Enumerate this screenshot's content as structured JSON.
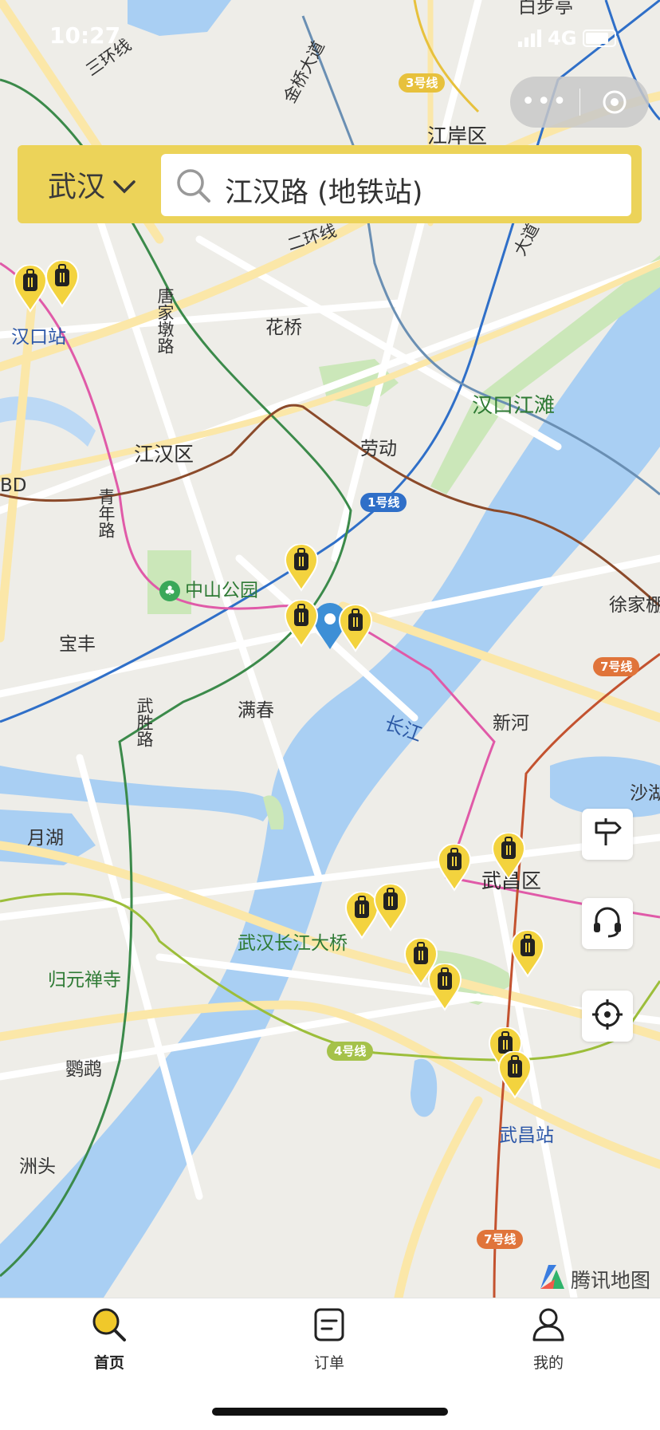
{
  "status_bar": {
    "time": "10:27",
    "network": "4G"
  },
  "capsule": {
    "more_icon": "more-dots-icon",
    "close_icon": "target-circle-icon"
  },
  "search": {
    "city": "武汉",
    "city_icon": "chevron-down-icon",
    "value": "江汉路 (地铁站)",
    "icon": "search-icon"
  },
  "map": {
    "labels": {
      "baibuting": "白步亭",
      "sanhuanxian": "三环线",
      "jinqiao": "金桥大道",
      "jianganqu": "江岸区",
      "erhuanxian": "二环线",
      "dadao": "大道",
      "huaqiao": "花桥",
      "hankouzhan": "汉口站",
      "tangjiadun": "唐家墩路",
      "hankoujiangtan": "汉口江滩",
      "jianghanqu": "江汉区",
      "laodong": "劳动",
      "qingnianlu": "青年路",
      "zhongshangongyuan": "中山公园",
      "xujiapeng": "徐家棚",
      "baofeng": "宝丰",
      "manchun": "满春",
      "changjiang": "长江",
      "xinhe": "新河",
      "wushenglu": "武胜路",
      "yuehu": "月湖",
      "shahu": "沙湖",
      "wuchangqu": "武昌区",
      "wuhanchangjiangdaqiao": "武汉长江大桥",
      "guiyuanchansi": "归元禅寺",
      "yingwu": "鹦鹉",
      "zhoutou": "洲头",
      "wuchangzhan": "武昌站",
      "cbd": "BD"
    },
    "badges": {
      "line3": "3号线",
      "line1": "1号线",
      "line7a": "7号线",
      "line4": "4号线",
      "line7b": "7号线"
    },
    "line_colors": {
      "line1": "#2f6fc8",
      "line3": "#e7c13c",
      "line4": "#9cbe3a",
      "line7": "#c3522f",
      "line2": "#e05aa8",
      "line6": "#3b8a4a",
      "line8": "#8b4a2a"
    }
  },
  "side_buttons": {
    "guide": "signpost-icon",
    "service": "headset-icon",
    "locate": "crosshair-icon"
  },
  "logo": {
    "text": "腾讯地图",
    "icon": "tencent-map-logo-icon"
  },
  "tabbar": {
    "home": {
      "label": "首页",
      "icon": "search-icon"
    },
    "orders": {
      "label": "订单",
      "icon": "order-icon"
    },
    "mine": {
      "label": "我的",
      "icon": "user-icon"
    }
  }
}
